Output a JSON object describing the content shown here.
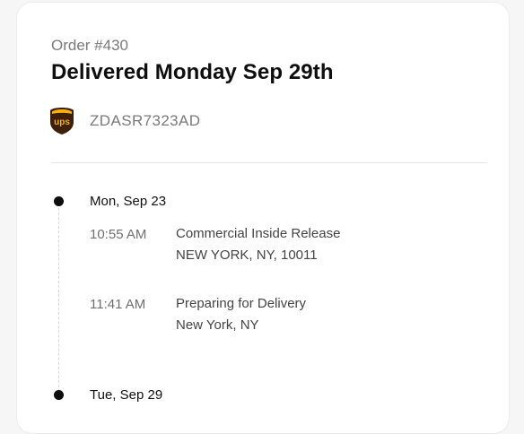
{
  "order": {
    "label": "Order #430",
    "status_title": "Delivered Monday Sep 29th"
  },
  "carrier": {
    "logo_text": "ups",
    "icon": "ups-shield-logo",
    "tracking_number": "ZDASR7323AD"
  },
  "timeline": {
    "days": [
      {
        "label": "Mon, Sep 23",
        "events": [
          {
            "time": "10:55 AM",
            "title": "Commercial Inside Release",
            "location": "NEW YORK, NY, 10011"
          },
          {
            "time": "11:41 AM",
            "title": "Preparing for Delivery",
            "location": "New York, NY"
          }
        ]
      },
      {
        "label": "Tue, Sep 29",
        "events": []
      }
    ]
  },
  "colors": {
    "ups_brown": "#3d1f0b",
    "ups_gold": "#f6b30f",
    "muted_text": "#7a7a7a"
  }
}
